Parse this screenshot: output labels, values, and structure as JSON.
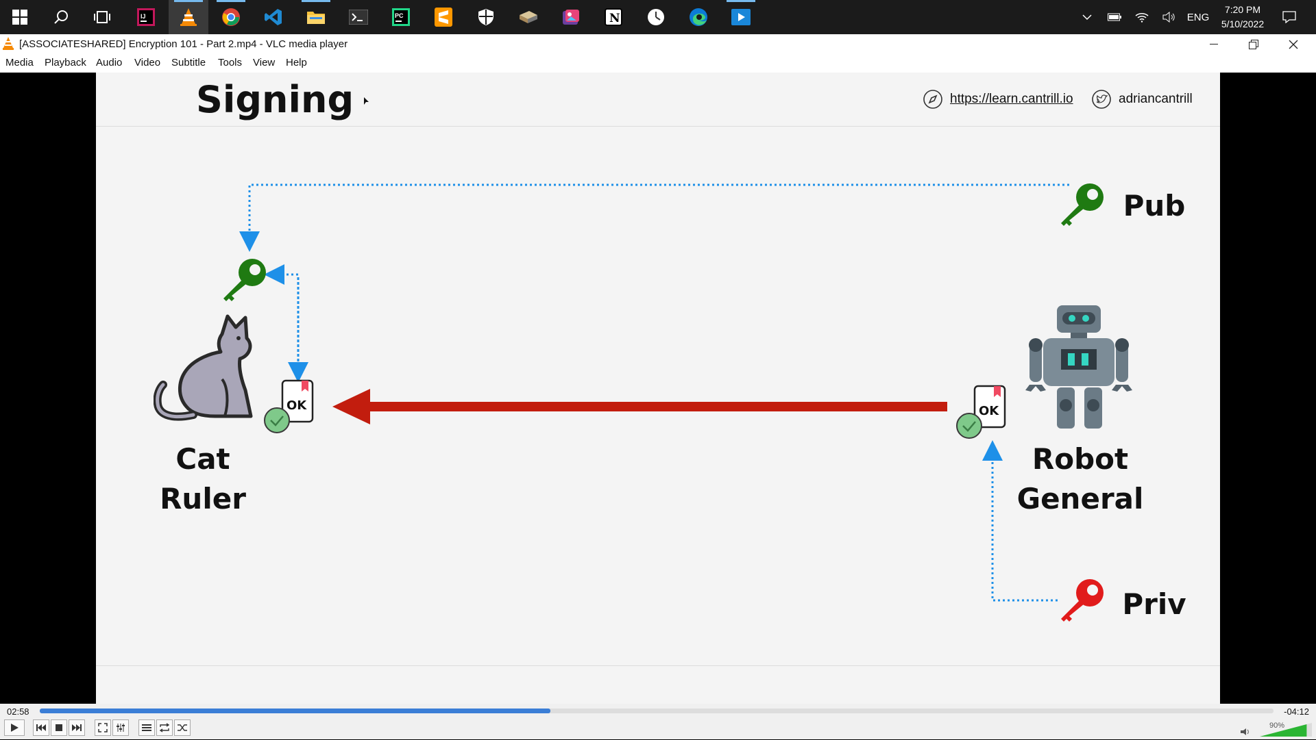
{
  "taskbar": {
    "icons": [
      "windows-start-icon",
      "search-icon",
      "task-view-icon",
      "intellij-icon",
      "vlc-icon",
      "chrome-icon",
      "vscode-icon",
      "file-explorer-icon",
      "terminal-icon",
      "pycharm-icon",
      "sublime-icon",
      "security-icon",
      "book-icon",
      "photos-icon",
      "notion-icon",
      "clock-app-icon",
      "edge-icon",
      "media-app-icon"
    ],
    "language": "ENG",
    "time": "7:20 PM",
    "date": "5/10/2022"
  },
  "window": {
    "title": "[ASSOCIATESHARED] Encryption 101 - Part 2.mp4 - VLC media player"
  },
  "menu": [
    "Media",
    "Playback",
    "Audio",
    "Video",
    "Subtitle",
    "Tools",
    "View",
    "Help"
  ],
  "slide": {
    "title": "Signing",
    "link": "https://learn.cantrill.io",
    "twitter": "adriancantrill",
    "pub_label": "Pub",
    "priv_label": "Priv",
    "cat_label_line1": "Cat",
    "cat_label_line2": "Ruler",
    "robot_label_line1": "Robot",
    "robot_label_line2": "General",
    "doc_text": "OK",
    "colors": {
      "pub_key": "#1f7a12",
      "priv_key": "#e11b1b",
      "arrow": "#c21d0e",
      "dotted": "#1e90e8"
    }
  },
  "player": {
    "elapsed": "02:58",
    "remaining": "-04:12",
    "progress": 0.414,
    "volume": "90%"
  }
}
